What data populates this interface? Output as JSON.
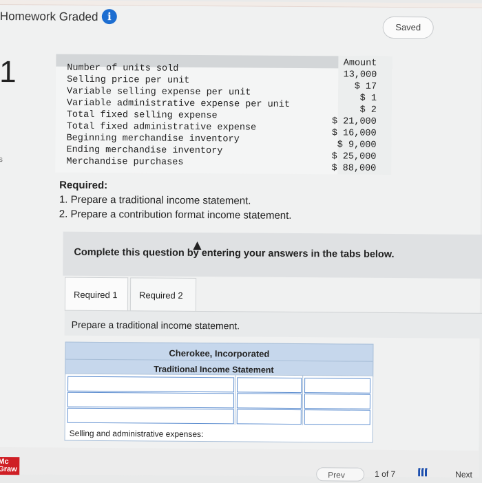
{
  "header": {
    "title": "Homework Graded",
    "info_icon": "i",
    "saved_label": "Saved"
  },
  "question": {
    "number": "1",
    "side_letter": "s"
  },
  "data_table": {
    "amount_header": "Amount",
    "rows": [
      {
        "label": "Number of units sold",
        "value": "13,000"
      },
      {
        "label": "Selling price per unit",
        "value": "$ 17"
      },
      {
        "label": "Variable selling expense per unit",
        "value": "$ 1"
      },
      {
        "label": "Variable administrative expense per unit",
        "value": "$ 2"
      },
      {
        "label": "Total fixed selling expense",
        "value": "$ 21,000"
      },
      {
        "label": "Total fixed administrative expense",
        "value": "$ 16,000"
      },
      {
        "label": "Beginning merchandise inventory",
        "value": "$ 9,000"
      },
      {
        "label": "Ending merchandise inventory",
        "value": "$ 25,000"
      },
      {
        "label": "Merchandise purchases",
        "value": "$ 88,000"
      }
    ]
  },
  "required": {
    "heading": "Required:",
    "items": [
      "1. Prepare a traditional income statement.",
      "2. Prepare a contribution format income statement."
    ]
  },
  "instructions": "Complete this question by entering your answers in the tabs below.",
  "tabs": [
    {
      "label": "Required 1"
    },
    {
      "label": "Required 2"
    }
  ],
  "panel_text": "Prepare a traditional income statement.",
  "income_statement": {
    "company": "Cherokee, Incorporated",
    "title": "Traditional Income Statement",
    "selling_admin_label": "Selling and administrative expenses:"
  },
  "footer": {
    "logo_line1": "Mc",
    "logo_line2": "Graw",
    "prev_label": "Prev",
    "page_text": "1 of 7",
    "next_label": "Next"
  },
  "colors": {
    "accent_blue": "#1d6ed1",
    "logo_red": "#cf1f25",
    "table_header_blue": "#c6d7ec"
  }
}
